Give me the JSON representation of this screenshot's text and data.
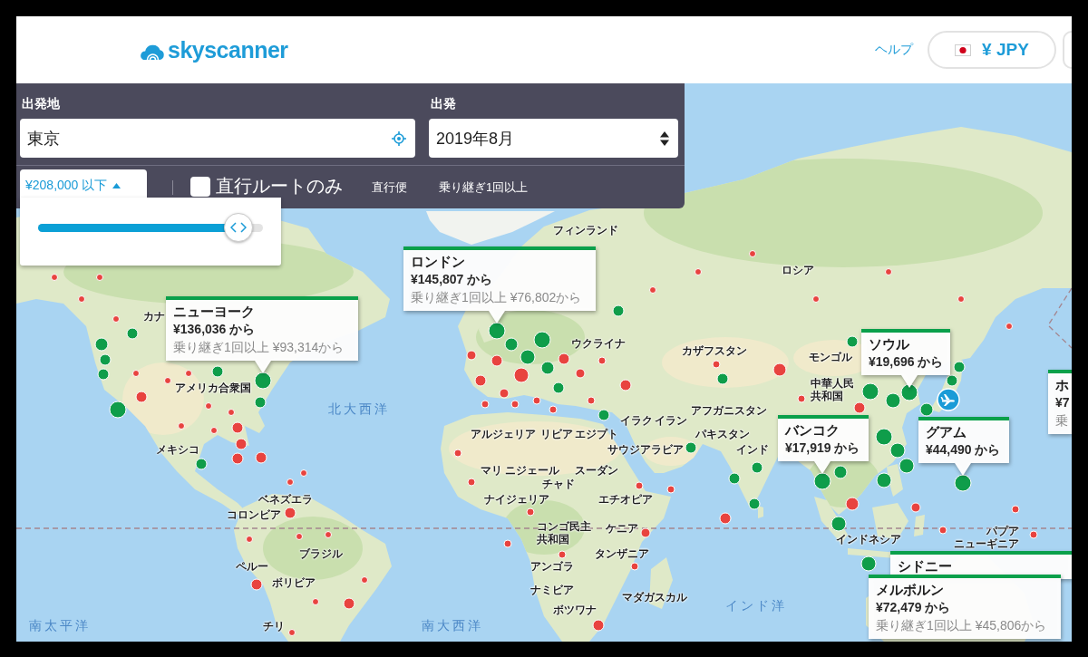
{
  "header": {
    "logo": "skyscanner",
    "help_link": "ヘルプ",
    "currency": "¥ JPY"
  },
  "search": {
    "origin_label": "出発地",
    "origin": "東京",
    "date_label": "出発",
    "date": "2019年8月"
  },
  "filters": {
    "price_button": "¥208,000 以下",
    "price_expanded": true,
    "price_slider": {
      "level": 0.89
    },
    "direct_only": {
      "label": "直行ルートのみ",
      "checked": false
    },
    "legend": [
      "直行便",
      "乗り継ぎ1回以上"
    ]
  },
  "map": {
    "labels": [
      {
        "text": "フィンランド",
        "kind": "country"
      },
      {
        "text": "ロシア",
        "kind": "country"
      },
      {
        "text": "カナ",
        "kind": "country"
      },
      {
        "text": "ウクライナ",
        "kind": "country"
      },
      {
        "text": "カザフスタン",
        "kind": "country"
      },
      {
        "text": "モンゴル",
        "kind": "country"
      },
      {
        "text": "アメリカ合衆国",
        "kind": "country"
      },
      {
        "text": "中華人民共和国",
        "kind": "country"
      },
      {
        "text": "北大西洋",
        "kind": "ocean"
      },
      {
        "text": "アフガニスタン",
        "kind": "country"
      },
      {
        "text": "イラク",
        "kind": "country"
      },
      {
        "text": "イラン",
        "kind": "country"
      },
      {
        "text": "アルジェリア",
        "kind": "country"
      },
      {
        "text": "リビア",
        "kind": "country"
      },
      {
        "text": "エジプト",
        "kind": "country"
      },
      {
        "text": "パキスタン",
        "kind": "country"
      },
      {
        "text": "メキシコ",
        "kind": "country"
      },
      {
        "text": "サウジアラビア",
        "kind": "country"
      },
      {
        "text": "インド",
        "kind": "country"
      },
      {
        "text": "マリ",
        "kind": "country"
      },
      {
        "text": "ニジェール",
        "kind": "country"
      },
      {
        "text": "スーダン",
        "kind": "country"
      },
      {
        "text": "チャド",
        "kind": "country"
      },
      {
        "text": "ベネズエラ",
        "kind": "country"
      },
      {
        "text": "ナイジェリア",
        "kind": "country"
      },
      {
        "text": "エチオピア",
        "kind": "country"
      },
      {
        "text": "コロンビア",
        "kind": "country"
      },
      {
        "text": "コンゴ民主共和国",
        "kind": "country"
      },
      {
        "text": "ケニア",
        "kind": "country"
      },
      {
        "text": "インドネシア",
        "kind": "country"
      },
      {
        "text": "パプアニューギニア",
        "kind": "country"
      },
      {
        "text": "ブラジル",
        "kind": "country"
      },
      {
        "text": "タンザニア",
        "kind": "country"
      },
      {
        "text": "ペルー",
        "kind": "country"
      },
      {
        "text": "アンゴラ",
        "kind": "country"
      },
      {
        "text": "ボリビア",
        "kind": "country"
      },
      {
        "text": "ナミビア",
        "kind": "country"
      },
      {
        "text": "マダガスカル",
        "kind": "country"
      },
      {
        "text": "ボツワナ",
        "kind": "country"
      },
      {
        "text": "インド洋",
        "kind": "ocean"
      },
      {
        "text": "南太平洋",
        "kind": "ocean"
      },
      {
        "text": "チリ",
        "kind": "country"
      },
      {
        "text": "南大西洋",
        "kind": "ocean"
      }
    ],
    "callouts": [
      {
        "city": "ロンドン",
        "price": "¥145,807 から",
        "connecting_price": "乗り継ぎ1回以上 ¥76,802から"
      },
      {
        "city": "ニューヨーク",
        "price": "¥136,036 から",
        "connecting_price": "乗り継ぎ1回以上 ¥93,314から"
      },
      {
        "city": "ソウル",
        "price": "¥19,696 から"
      },
      {
        "city": "ホ",
        "price": "¥7",
        "connecting_price": "乗"
      },
      {
        "city": "バンコク",
        "price": "¥17,919 から"
      },
      {
        "city": "グアム",
        "price": "¥44,490 から"
      },
      {
        "city": "シドニー"
      },
      {
        "city": "メルボルン",
        "price": "¥72,479 から",
        "connecting_price": "乗り継ぎ1回以上 ¥45,806から"
      }
    ],
    "markers": [
      {
        "color": "#0f9d4a"
      },
      {
        "color": "#0f9d4a"
      },
      {
        "color": "#0f9d4a"
      },
      {
        "color": "#0f9d4a"
      },
      {
        "color": "#0f9d4a"
      },
      {
        "color": "#e8433f"
      },
      {
        "color": "#0f9d4a"
      },
      {
        "color": "#0f9d4a"
      },
      {
        "color": "#0f9d4a"
      },
      {
        "color": "#e8433f"
      },
      {
        "color": "#e8433f"
      },
      {
        "color": "#e8433f"
      },
      {
        "color": "#e8433f"
      },
      {
        "color": "#e8433f"
      },
      {
        "color": "#e8433f"
      },
      {
        "color": "#e8433f"
      },
      {
        "color": "#e8433f"
      },
      {
        "color": "#0f9d4a"
      },
      {
        "color": "#e8433f"
      },
      {
        "color": "#e8433f"
      },
      {
        "color": "#e8433f"
      },
      {
        "color": "#e8433f"
      },
      {
        "color": "#e8433f"
      },
      {
        "color": "#e8433f"
      },
      {
        "color": "#e8433f"
      },
      {
        "color": "#e8433f"
      },
      {
        "color": "#e8433f"
      },
      {
        "color": "#e8433f"
      },
      {
        "color": "#e8433f"
      },
      {
        "color": "#e8433f"
      },
      {
        "color": "#e8433f"
      },
      {
        "color": "#e8433f"
      },
      {
        "color": "#e8433f"
      },
      {
        "color": "#e8433f"
      },
      {
        "color": "#e8433f"
      },
      {
        "color": "#e8433f"
      },
      {
        "color": "#0f9d4a"
      },
      {
        "color": "#0f9d4a"
      },
      {
        "color": "#0f9d4a"
      },
      {
        "color": "#0f9d4a"
      },
      {
        "color": "#e8433f"
      },
      {
        "color": "#e8433f"
      },
      {
        "color": "#0f9d4a"
      },
      {
        "color": "#e8433f"
      },
      {
        "color": "#e8433f"
      },
      {
        "color": "#e8433f"
      },
      {
        "color": "#0f9d4a"
      },
      {
        "color": "#e8433f"
      },
      {
        "color": "#0f9d4a"
      },
      {
        "color": "#e8433f"
      },
      {
        "color": "#e8433f"
      },
      {
        "color": "#e8433f"
      },
      {
        "color": "#e8433f"
      },
      {
        "color": "#e8433f"
      },
      {
        "color": "#e8433f"
      },
      {
        "color": "#e8433f"
      },
      {
        "color": "#0f9d4a"
      },
      {
        "color": "#e8433f"
      },
      {
        "color": "#0f9d4a"
      },
      {
        "color": "#e8433f"
      },
      {
        "color": "#e8433f"
      },
      {
        "color": "#e8433f"
      },
      {
        "color": "#e8433f"
      },
      {
        "color": "#e8433f"
      },
      {
        "color": "#e8433f"
      },
      {
        "color": "#e8433f"
      },
      {
        "color": "#e8433f"
      },
      {
        "color": "#e8433f"
      },
      {
        "color": "#e8433f"
      },
      {
        "color": "#0f9d4a"
      },
      {
        "color": "#0f9d4a"
      },
      {
        "color": "#0f9d4a"
      },
      {
        "color": "#0f9d4a"
      },
      {
        "color": "#e8433f"
      },
      {
        "color": "#0f9d4a"
      },
      {
        "color": "#0f9d4a"
      },
      {
        "color": "#0f9d4a"
      },
      {
        "color": "#0f9d4a"
      },
      {
        "color": "#0f9d4a"
      },
      {
        "color": "#0f9d4a"
      },
      {
        "color": "#0f9d4a"
      },
      {
        "color": "#0f9d4a"
      },
      {
        "color": "#0f9d4a"
      },
      {
        "color": "#0f9d4a"
      },
      {
        "color": "#0f9d4a"
      },
      {
        "color": "#0f9d4a"
      },
      {
        "color": "#0f9d4a"
      },
      {
        "color": "#e8433f"
      },
      {
        "color": "#0f9d4a"
      },
      {
        "color": "#0f9d4a"
      },
      {
        "color": "#0f9d4a"
      },
      {
        "color": "#e8433f"
      },
      {
        "color": "#e8433f"
      },
      {
        "color": "#e8433f"
      },
      {
        "color": "#e8433f"
      },
      {
        "color": "#e8433f"
      },
      {
        "color": "#e8433f"
      },
      {
        "color": "#e8433f"
      },
      {
        "color": "#e8433f"
      },
      {
        "color": "#e8433f"
      },
      {
        "color": "#e8433f"
      },
      {
        "color": "#e8433f"
      },
      {
        "color": "#e8433f"
      },
      {
        "color": "#e8433f"
      },
      {
        "color": "#e8433f"
      },
      {
        "color": "#e8433f"
      }
    ]
  }
}
